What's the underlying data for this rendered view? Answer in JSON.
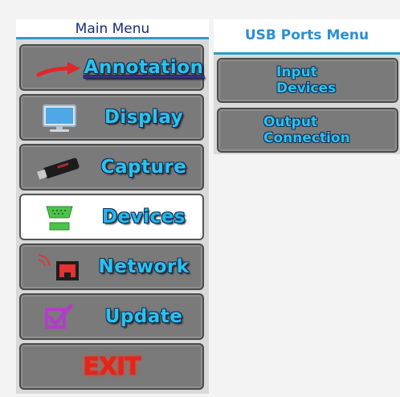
{
  "main_menu": {
    "title": "Main Menu",
    "items": [
      {
        "label": "Annotation",
        "icon": "red-arrow-icon"
      },
      {
        "label": "Display",
        "icon": "monitor-icon"
      },
      {
        "label": "Capture",
        "icon": "usb-stick-icon"
      },
      {
        "label": "Devices",
        "icon": "serial-port-icon",
        "selected": true
      },
      {
        "label": "Network",
        "icon": "network-port-icon"
      },
      {
        "label": "Update",
        "icon": "checkbox-icon"
      },
      {
        "label": "EXIT",
        "icon": "exit-sign"
      }
    ]
  },
  "usb_menu": {
    "title": "USB Ports Menu",
    "items": [
      {
        "line1": "Input",
        "line2": "Devices"
      },
      {
        "line1": "Output",
        "line2": "Connection"
      }
    ]
  },
  "colors": {
    "accent": "#2c9ec4",
    "label": "#29c4ec",
    "exit": "#e3251b"
  }
}
